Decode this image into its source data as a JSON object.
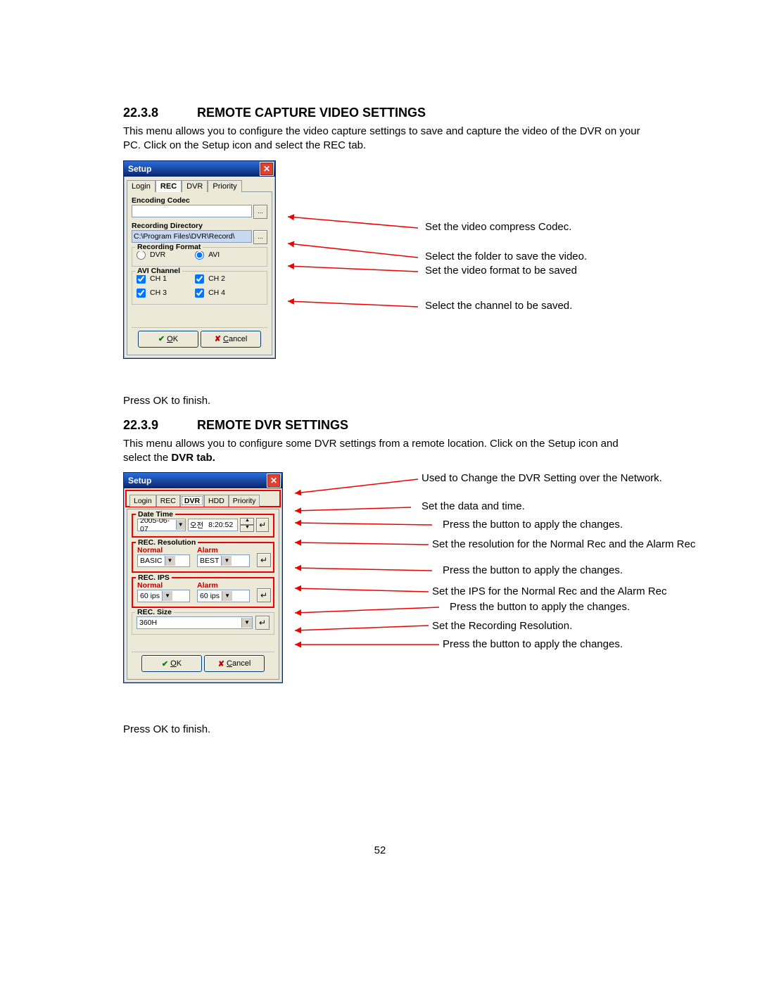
{
  "section1": {
    "num": "22.3.8",
    "title": "REMOTE CAPTURE VIDEO SETTINGS",
    "para": "This menu allows you to configure the video capture settings to save and capture the video of the DVR on your PC.  Click on the Setup icon and select the REC tab.",
    "press_ok": "Press OK to finish."
  },
  "section2": {
    "num": "22.3.9",
    "title": "REMOTE DVR SETTINGS",
    "para_a": "This menu allows you to configure some DVR settings from a remote location. Click on the Setup icon and select the ",
    "para_b_bold": "DVR tab.",
    "press_ok": "Press OK to finish."
  },
  "dialog1": {
    "title": "Setup",
    "tabs": [
      "Login",
      "REC",
      "DVR",
      "Priority"
    ],
    "encoding_codec_label": "Encoding Codec",
    "encoding_codec_value": "",
    "recording_directory_label": "Recording Directory",
    "recording_directory_value": "C:\\Program Files\\DVR\\Record\\",
    "recording_format_label": "Recording Format",
    "fmt_dvr": "DVR",
    "fmt_avi": "AVI",
    "avi_channel_label": "AVI Channel",
    "ch1": "CH 1",
    "ch2": "CH 2",
    "ch3": "CH 3",
    "ch4": "CH 4",
    "ok": "OK",
    "cancel": "Cancel",
    "browse": "..."
  },
  "dialog2": {
    "title": "Setup",
    "tabs": [
      "Login",
      "REC",
      "DVR",
      "HDD",
      "Priority"
    ],
    "date_time_label": "Date Time",
    "date_value": "2005-06-07",
    "time_prefix": "오전",
    "time_value": "8:20:52",
    "rec_resolution_label": "REC. Resolution",
    "normal_label": "Normal",
    "alarm_label": "Alarm",
    "res_normal": "BASIC",
    "res_alarm": "BEST",
    "rec_ips_label": "REC. IPS",
    "ips_normal": "60 ips",
    "ips_alarm": "60 ips",
    "rec_size_label": "REC. Size",
    "rec_size_value": "360H",
    "ok": "OK",
    "cancel": "Cancel",
    "apply": "↵"
  },
  "callouts1": {
    "c1": "Set the video compress Codec.",
    "c2": "Select the folder to save the video.",
    "c3": "Set the video format to be saved",
    "c4": "Select the channel to be saved."
  },
  "callouts2": {
    "c1": "Used to Change the DVR Setting over the Network.",
    "c2": "Set the data and time.",
    "c3": "Press the button to apply the changes.",
    "c4": "Set the resolution for the Normal Rec and the Alarm Rec",
    "c5": "Press the button to apply the changes.",
    "c6": "Set the IPS for the Normal Rec and the Alarm Rec",
    "c7": "Press the button to apply the changes.",
    "c8": "Set the Recording Resolution.",
    "c9": "Press the button to apply the changes."
  },
  "page_number": "52"
}
